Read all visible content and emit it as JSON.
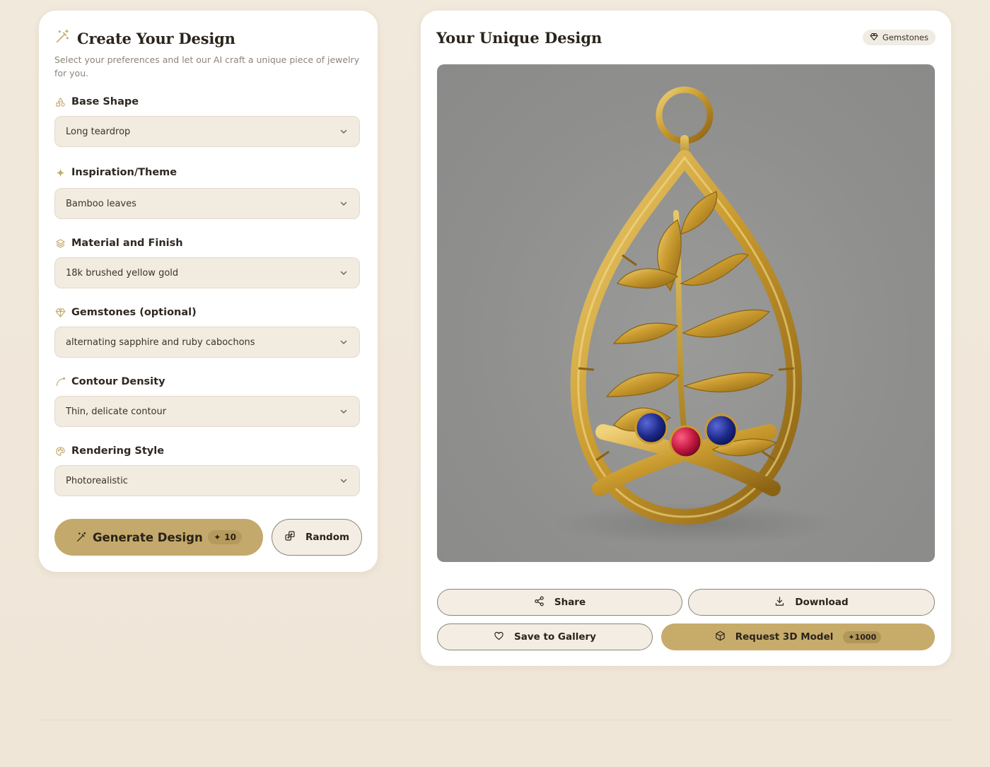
{
  "left_panel": {
    "title": "Create Your Design",
    "subtitle": "Select your preferences and let our AI craft a unique piece of jewelry for you.",
    "fields": [
      {
        "label": "Base Shape",
        "icon": "shapes-icon",
        "value": "Long teardrop"
      },
      {
        "label": "Inspiration/Theme",
        "icon": "sparkle-icon",
        "value": "Bamboo leaves"
      },
      {
        "label": "Material and Finish",
        "icon": "layers-icon",
        "value": "18k brushed yellow gold"
      },
      {
        "label": "Gemstones (optional)",
        "icon": "gem-icon",
        "value": "alternating sapphire and ruby cabochons"
      },
      {
        "label": "Contour Density",
        "icon": "curve-icon",
        "value": "Thin, delicate contour"
      },
      {
        "label": "Rendering Style",
        "icon": "palette-icon",
        "value": "Photorealistic"
      }
    ],
    "generate_label": "Generate Design",
    "generate_cost": "10",
    "random_label": "Random"
  },
  "right_panel": {
    "title": "Your Unique Design",
    "badge_label": "Gemstones",
    "share_label": "Share",
    "download_label": "Download",
    "save_label": "Save to Gallery",
    "request_label": "Request 3D Model",
    "request_cost": "1000"
  },
  "colors": {
    "accent_gold": "#c3a96b",
    "page_bg": "#f1e9dc",
    "field_bg": "#f2ebe0",
    "sapphire": "#1e2a8a",
    "ruby": "#c0163e"
  }
}
